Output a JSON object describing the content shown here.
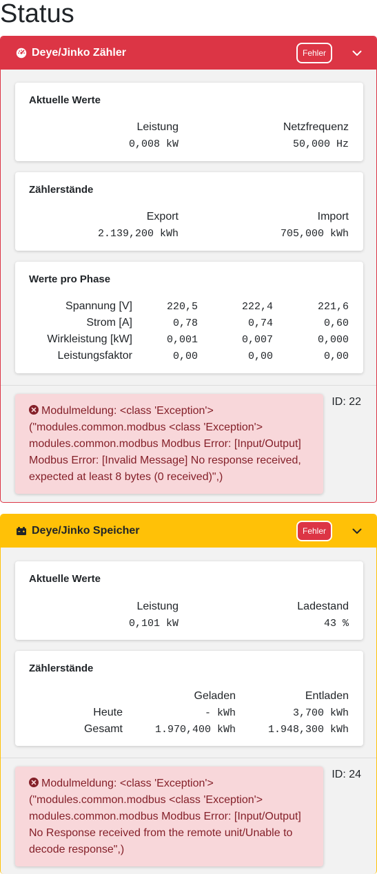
{
  "page": {
    "title": "Status"
  },
  "meter": {
    "title": "Deye/Jinko Zähler",
    "badge": "Fehler",
    "icon": "gauge-icon",
    "current": {
      "heading": "Aktuelle Werte",
      "power_label": "Leistung",
      "power_value": "0,008 kW",
      "freq_label": "Netzfrequenz",
      "freq_value": "50,000 Hz"
    },
    "counters": {
      "heading": "Zählerstände",
      "export_label": "Export",
      "export_value": "2.139,200 kWh",
      "import_label": "Import",
      "import_value": "705,000 kWh"
    },
    "phases": {
      "heading": "Werte pro Phase",
      "rows": [
        {
          "label": "Spannung [V]",
          "values": [
            "220,5",
            "222,4",
            "221,6"
          ]
        },
        {
          "label": "Strom [A]",
          "values": [
            "0,78",
            "0,74",
            "0,60"
          ]
        },
        {
          "label": "Wirkleistung [kW]",
          "values": [
            "0,001",
            "0,007",
            "0,000"
          ]
        },
        {
          "label": "Leistungsfaktor",
          "values": [
            "0,00",
            "0,00",
            "0,00"
          ]
        }
      ]
    },
    "message": "Modulmeldung: <class 'Exception'> (\"modules.common.modbus <class 'Exception'> modules.common.modbus Modbus Error: [Input/Output] Modbus Error: [Invalid Message] No response received, expected at least 8 bytes (0 received)\",)",
    "id": "ID: 22"
  },
  "storage": {
    "title": "Deye/Jinko Speicher",
    "badge": "Fehler",
    "icon": "battery-icon",
    "current": {
      "heading": "Aktuelle Werte",
      "power_label": "Leistung",
      "power_value": "0,101 kW",
      "soc_label": "Ladestand",
      "soc_value": "43 %"
    },
    "counters": {
      "heading": "Zählerstände",
      "charged_label": "Geladen",
      "discharged_label": "Entladen",
      "today_label": "Heute",
      "today_charged": "- kWh",
      "today_discharged": "3,700 kWh",
      "total_label": "Gesamt",
      "total_charged": "1.970,400 kWh",
      "total_discharged": "1.948,300 kWh"
    },
    "message": "Modulmeldung: <class 'Exception'> (\"modules.common.modbus <class 'Exception'> modules.common.modbus Modbus Error: [Input/Output] No Response received from the remote unit/Unable to decode response\",)",
    "id": "ID: 24"
  },
  "colors": {
    "danger": "#dc3545",
    "warning": "#ffc107",
    "alert_bg": "#f8d7da",
    "alert_text": "#842029"
  }
}
